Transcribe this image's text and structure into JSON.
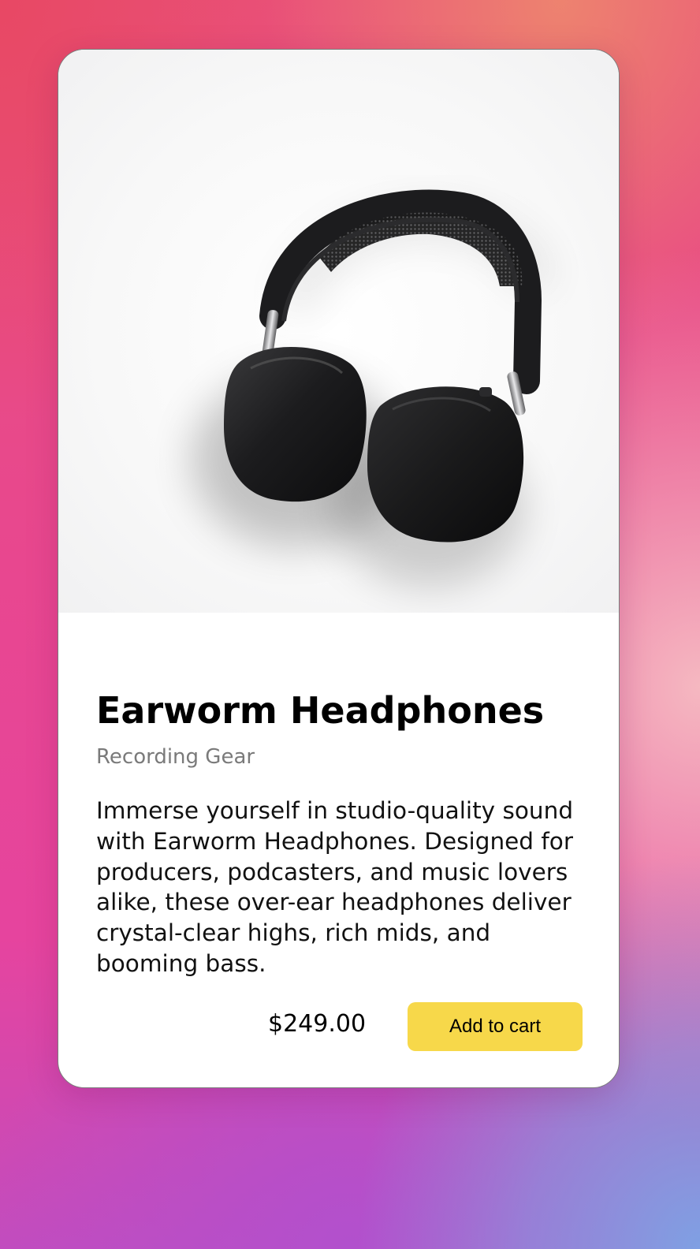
{
  "product": {
    "image_alt": "headphones",
    "name": "Earworm Headphones",
    "category": "Recording Gear",
    "description": "Immerse yourself in studio-quality sound with Earworm Headphones. Designed for producers, podcasters, and music lovers alike, these over-ear headphones deliver crystal-clear highs, rich mids, and booming bass.",
    "price": "$249.00",
    "add_to_cart_label": "Add to cart"
  },
  "colors": {
    "button": "#f7d84a",
    "category_text": "#7a7a7a",
    "card_background": "#ffffff"
  }
}
